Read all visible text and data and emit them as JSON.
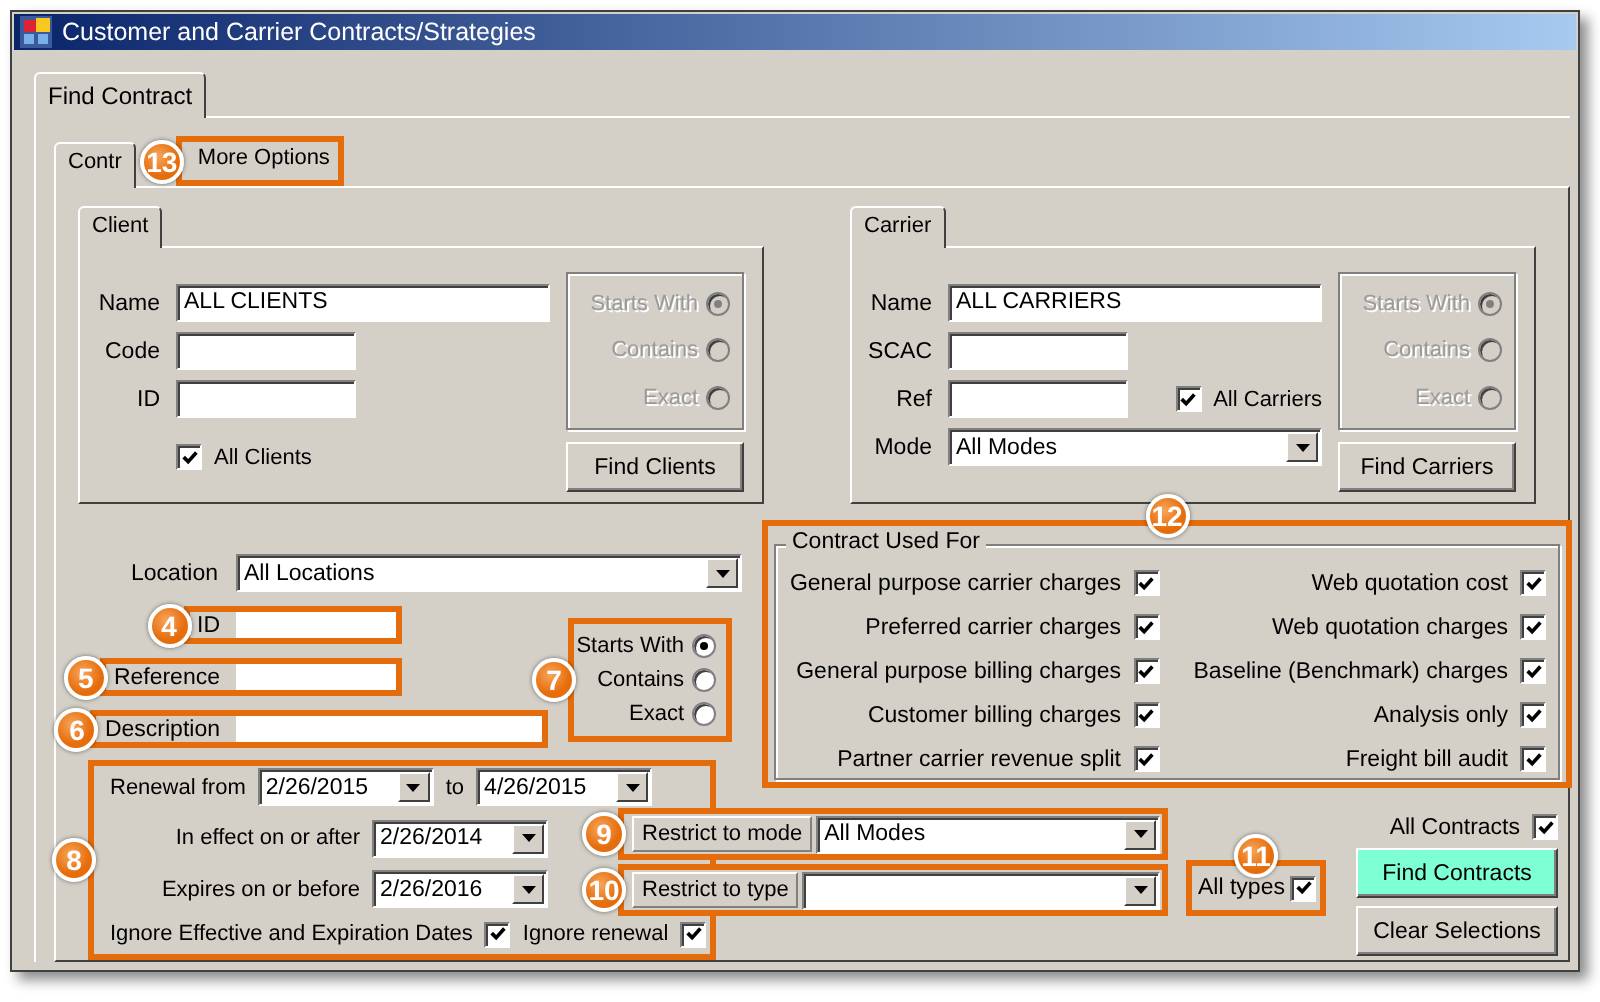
{
  "window": {
    "title": "Customer and Carrier Contracts/Strategies"
  },
  "outer_tabs": [
    {
      "label": "Find Contract",
      "selected": true
    }
  ],
  "inner_tabs": [
    {
      "label": "Contr",
      "selected": true
    },
    {
      "label": "More Options",
      "selected": false,
      "badge": "13"
    }
  ],
  "client": {
    "tab": "Client",
    "fields": [
      {
        "label": "Name",
        "value": "ALL CLIENTS",
        "kind": "wide"
      },
      {
        "label": "Code",
        "kind": "short"
      },
      {
        "label": "ID",
        "kind": "short"
      }
    ],
    "checkbox": {
      "label": "All Clients",
      "checked": true
    },
    "match": {
      "disabled": true,
      "options": [
        {
          "label": "Starts With",
          "selected": true
        },
        {
          "label": "Contains",
          "selected": false
        },
        {
          "label": "Exact",
          "selected": false
        }
      ]
    },
    "button": "Find Clients"
  },
  "carrier": {
    "tab": "Carrier",
    "fields": [
      {
        "label": "Name",
        "value": "ALL CARRIERS",
        "kind": "wide"
      },
      {
        "label": "SCAC",
        "kind": "short"
      },
      {
        "label": "Ref",
        "kind": "short"
      },
      {
        "label": "Mode",
        "value": "All Modes",
        "kind": "dropdown"
      }
    ],
    "checkbox": {
      "label": "All Carriers",
      "checked": true
    },
    "match": {
      "disabled": true,
      "options": [
        {
          "label": "Starts With",
          "selected": true
        },
        {
          "label": "Contains",
          "selected": false
        },
        {
          "label": "Exact",
          "selected": false
        }
      ]
    },
    "button": "Find Carriers"
  },
  "location": {
    "label": "Location",
    "value": "All Locations"
  },
  "search_fields": [
    {
      "label": "ID",
      "kind": "short",
      "badge": "4"
    },
    {
      "label": "Reference",
      "kind": "short",
      "badge": "5"
    },
    {
      "label": "Description",
      "kind": "long",
      "badge": "6"
    }
  ],
  "text_match": {
    "badge": "7",
    "options": [
      {
        "label": "Starts With",
        "selected": true
      },
      {
        "label": "Contains",
        "selected": false
      },
      {
        "label": "Exact",
        "selected": false
      }
    ]
  },
  "dates": {
    "badge": "8",
    "renewal": {
      "label": "Renewal from",
      "from": "2/26/2015",
      "to_label": "to",
      "to": "4/26/2015"
    },
    "in_effect": {
      "label": "In effect on or after",
      "value": "2/26/2014"
    },
    "expires": {
      "label": "Expires on or before",
      "value": "2/26/2016"
    },
    "ignore_dates": {
      "label": "Ignore Effective and Expiration Dates",
      "checked": true
    },
    "ignore_renewal": {
      "label": "Ignore renewal",
      "checked": true
    }
  },
  "restrictions": [
    {
      "badge": "9",
      "label": "Restrict to mode",
      "value": "All Modes"
    },
    {
      "badge": "10",
      "label": "Restrict to type"
    }
  ],
  "contract_used_for": {
    "badge": "12",
    "title": "Contract Used For",
    "items": [
      {
        "label": "General purpose carrier charges",
        "checked": true
      },
      {
        "label": "Web quotation cost",
        "checked": true
      },
      {
        "label": "Preferred carrier charges",
        "checked": true
      },
      {
        "label": "Web quotation charges",
        "checked": true
      },
      {
        "label": "General purpose billing charges",
        "checked": true
      },
      {
        "label": "Baseline (Benchmark) charges",
        "checked": true
      },
      {
        "label": "Customer billing charges",
        "checked": true
      },
      {
        "label": "Analysis only",
        "checked": true
      },
      {
        "label": "Partner carrier revenue split",
        "checked": true
      },
      {
        "label": "Freight bill audit",
        "checked": true
      }
    ]
  },
  "all_types": {
    "badge": "11",
    "label": "All types",
    "checked": true
  },
  "all_contracts": {
    "label": "All Contracts",
    "checked": true
  },
  "buttons": [
    {
      "label": "Find Contracts",
      "kind": "primary"
    },
    {
      "label": "Clear Selections",
      "kind": "normal"
    }
  ]
}
